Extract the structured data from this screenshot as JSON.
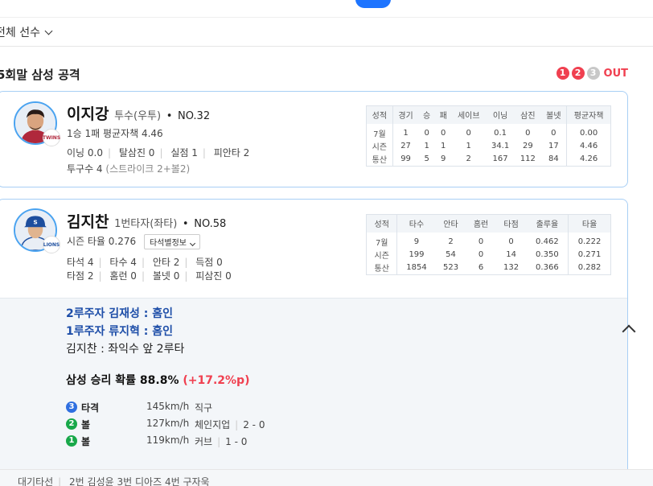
{
  "filter": {
    "label": "전체 선수"
  },
  "inning": {
    "title": "5회말 삼성 공격",
    "outs": [
      "1",
      "2",
      "3"
    ],
    "outs_on": 2,
    "out_label": "OUT"
  },
  "pitcher": {
    "name": "이지강",
    "position": "투수(우투)",
    "number": "NO.32",
    "record": "1승 1패 평균자책 4.46",
    "line1": {
      "innings": "이닝 0.0",
      "strikeouts": "탈삼진 0",
      "runs": "실점 1",
      "hits": "피안타 2"
    },
    "pitches": "투구수 4",
    "pitches_detail": "(스트라이크 2+볼2)",
    "team_badge": "TWINS",
    "table": {
      "headers": [
        "성적",
        "경기",
        "승",
        "패",
        "세이브",
        "이닝",
        "삼진",
        "볼넷",
        "평균자책"
      ],
      "rows": [
        [
          "7월",
          "1",
          "0",
          "0",
          "0",
          "0.1",
          "0",
          "0",
          "0.00"
        ],
        [
          "시즌",
          "27",
          "1",
          "1",
          "1",
          "34.1",
          "29",
          "17",
          "4.46"
        ],
        [
          "통산",
          "99",
          "5",
          "9",
          "2",
          "167",
          "112",
          "84",
          "4.26"
        ]
      ]
    }
  },
  "batter": {
    "name": "김지찬",
    "position": "1번타자(좌타)",
    "number": "NO.58",
    "season_avg": "시즌 타율 0.276",
    "select_label": "타석별정보",
    "line1": {
      "pa": "타석 4",
      "ab": "타수 4",
      "hits": "안타 2",
      "runs": "득점 0"
    },
    "line2": {
      "rbi": "타점 2",
      "hr": "홈런 0",
      "bb": "볼넷 0",
      "so": "피삼진 0"
    },
    "team_badge": "LIONS",
    "table": {
      "headers": [
        "성적",
        "타수",
        "안타",
        "홈런",
        "타점",
        "출루율",
        "타율"
      ],
      "rows": [
        [
          "7월",
          "9",
          "2",
          "0",
          "0",
          "0.462",
          "0.222"
        ],
        [
          "시즌",
          "199",
          "54",
          "0",
          "14",
          "0.350",
          "0.271"
        ],
        [
          "통산",
          "1854",
          "523",
          "6",
          "132",
          "0.366",
          "0.282"
        ]
      ]
    }
  },
  "play": {
    "runner1": "2루주자 김재성 : 홈인",
    "runner2": "1루주자 류지혁 : 홈인",
    "result": "김지찬 : 좌익수 앞 2루타",
    "winprob_label": "삼성 승리 확률 88.8%",
    "winprob_delta": "(+17.2%p)",
    "pitches": [
      {
        "num": "3",
        "result": "타격",
        "speed": "145km/h",
        "type": "직구",
        "count": "",
        "color": "#2f6fe0"
      },
      {
        "num": "2",
        "result": "볼",
        "speed": "127km/h",
        "type": "체인지업",
        "count": "2 - 0",
        "color": "#18a84a"
      },
      {
        "num": "1",
        "result": "볼",
        "speed": "119km/h",
        "type": "커브",
        "count": "1 - 0",
        "color": "#18a84a"
      }
    ]
  },
  "bottom": {
    "label": "대기타선",
    "items": [
      "2번 김성윤",
      "3번 디아즈",
      "4번 구자욱"
    ]
  },
  "colors": {
    "accent": "#1d74ff",
    "out": "#f04050",
    "runner": "#1e4ea8",
    "border": "#a8cff5"
  }
}
